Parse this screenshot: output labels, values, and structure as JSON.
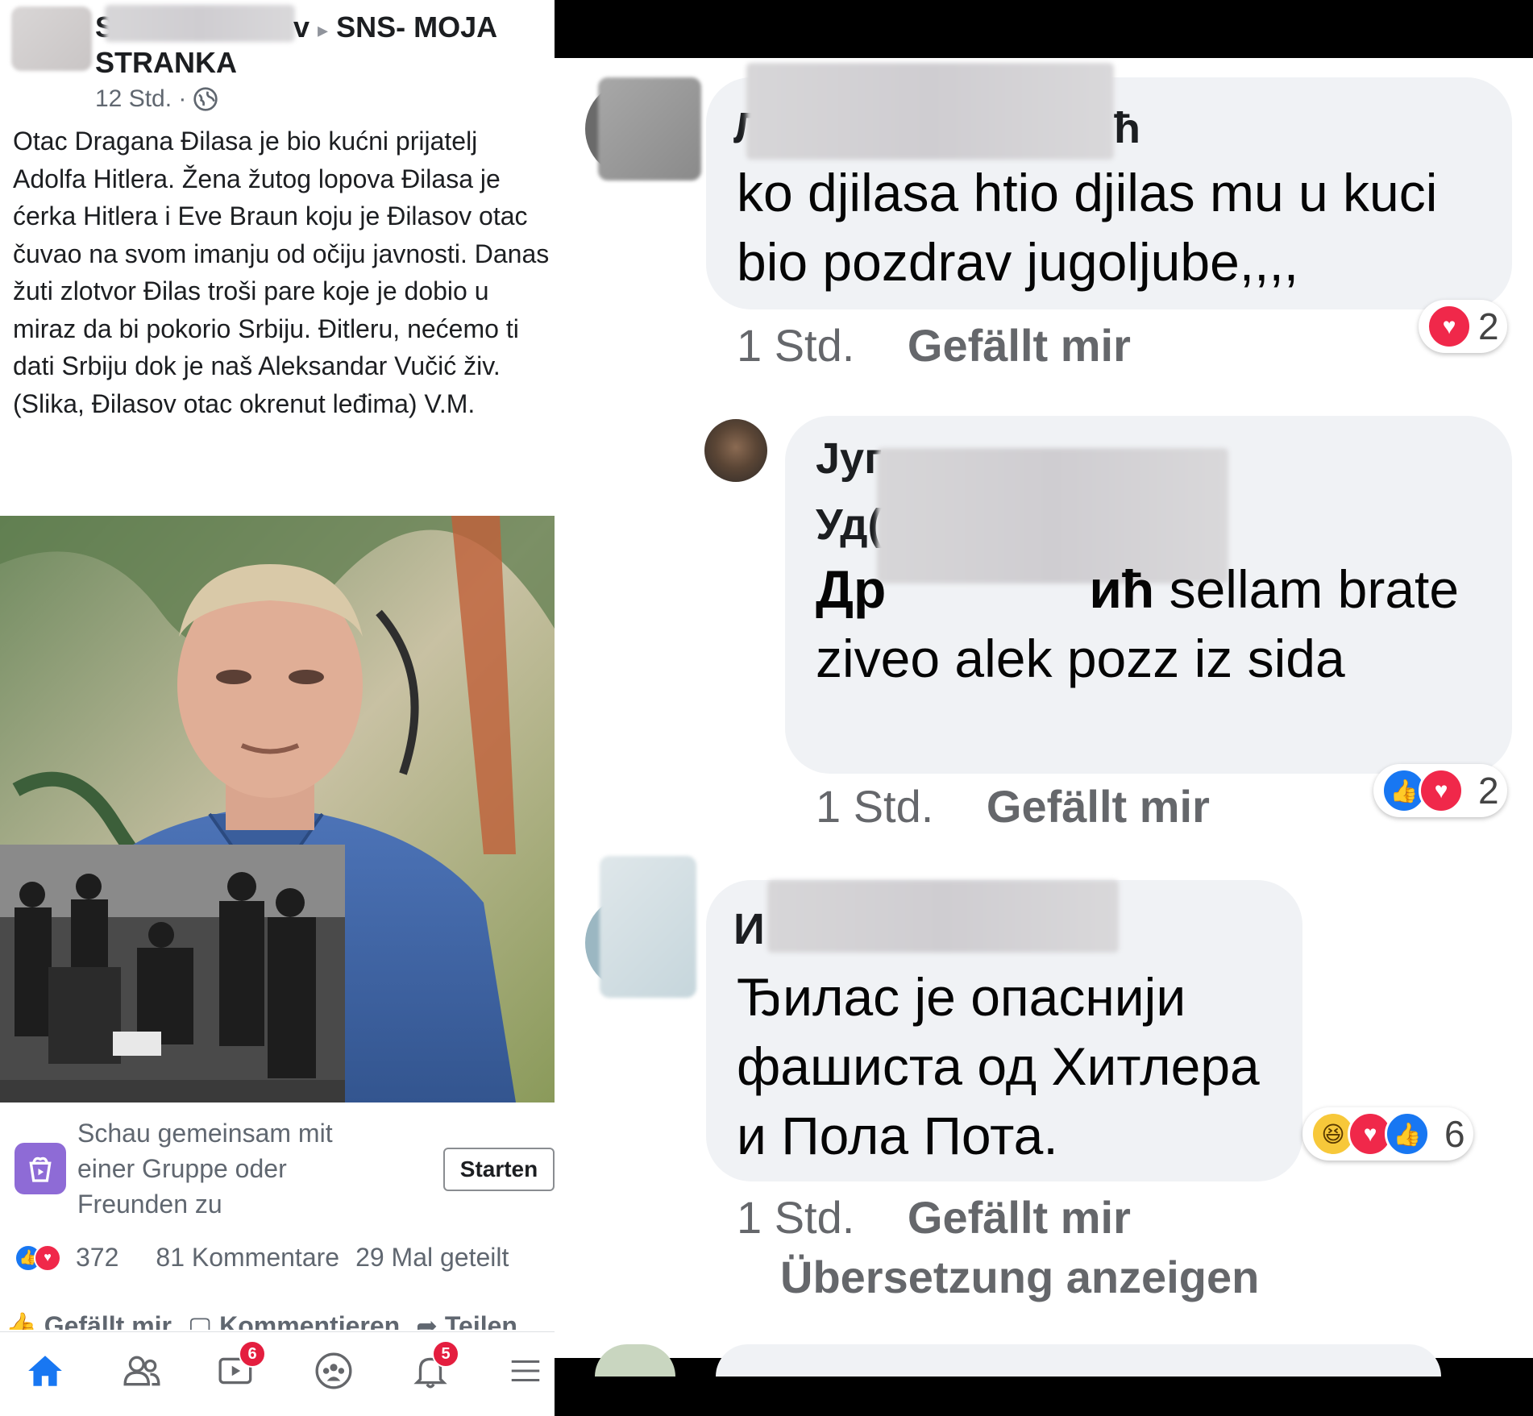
{
  "post": {
    "page_name_end": "v",
    "arrow": "▸",
    "group_name_line1": "SNS- MOJA",
    "group_name_line2": "STRANKA",
    "time": "12 Std. ·",
    "text": "Otac Dragana Đilasa je bio kućni prijatelj Adolfa Hitlera. Žena žutog lopova Đilasa je ćerka Hitlera i Eve Braun koju je Đilasov otac čuvao na svom imanju od očiju javnosti. Danas žuti zlotvor Đilas troši pare koje je dobio u miraz da bi pokorio Srbiju. Đitleru, nećemo ti dati Srbiju dok je naš Aleksandar Vučić živ. (Slika, Đilasov otac okrenut leđima) V.M.",
    "watch_together": {
      "line1": "Schau gemeinsam mit",
      "line2": "einer Gruppe oder",
      "line3": "Freunden zu",
      "button": "Starten"
    },
    "stats": {
      "reactions": "372",
      "comments": "81 Kommentare",
      "shares": "29 Mal geteilt"
    },
    "actions": {
      "like": "Gefällt mir",
      "comment": "Kommentieren",
      "share": "Teilen"
    }
  },
  "tabbar": {
    "items": [
      {
        "icon": "home-icon"
      },
      {
        "icon": "friends-icon"
      },
      {
        "icon": "watch-icon",
        "badge": "6"
      },
      {
        "icon": "groups-icon"
      },
      {
        "icon": "bell-icon",
        "badge": "5"
      },
      {
        "icon": "menu-icon"
      }
    ]
  },
  "comments": [
    {
      "name_end": "ћ",
      "text": "ko djilasa htio djilas mu u kuci bio pozdrav jugoljube,,,,",
      "time": "1 Std.",
      "like": "Gefällt mir",
      "reaction_count": "2"
    },
    {
      "name_line1": "Југ",
      "name_line2": "Уд(",
      "mention_start": "Др",
      "mention_end": "иħ",
      "text_line1": "sellam",
      "text_rest": "brate ziveo alek pozz iz sida",
      "time": "1 Std.",
      "like": "Gefällt mir",
      "reaction_count": "2"
    },
    {
      "name_start": "И",
      "text": "Ђилас је опаснији фашиста од Хитлера и Пола Пота.",
      "time": "1 Std.",
      "like": "Gefällt mir",
      "translate": "Übersetzung anzeigen",
      "reaction_count": "6"
    }
  ],
  "colors": {
    "fb_blue": "#1877f2",
    "heart_red": "#f0284a",
    "bubble_bg": "#f0f2f5",
    "meta_gray": "#65676b"
  }
}
